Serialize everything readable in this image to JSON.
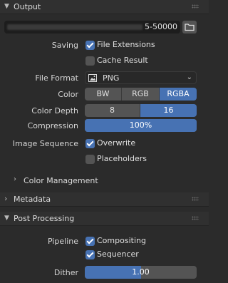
{
  "output": {
    "header": "Output",
    "path_value": "5-50000",
    "saving_label": "Saving",
    "file_extensions_label": "File Extensions",
    "file_extensions_checked": true,
    "cache_result_label": "Cache Result",
    "cache_result_checked": false,
    "file_format_label": "File Format",
    "file_format_value": "PNG",
    "color_label": "Color",
    "color_options": [
      "BW",
      "RGB",
      "RGBA"
    ],
    "color_selected": "RGBA",
    "color_depth_label": "Color Depth",
    "color_depth_options": [
      "8",
      "16"
    ],
    "color_depth_selected": "16",
    "compression_label": "Compression",
    "compression_value": "100%",
    "compression_fraction": 1.0,
    "image_sequence_label": "Image Sequence",
    "overwrite_label": "Overwrite",
    "overwrite_checked": true,
    "placeholders_label": "Placeholders",
    "placeholders_checked": false,
    "color_management_label": "Color Management"
  },
  "metadata": {
    "header": "Metadata"
  },
  "post_processing": {
    "header": "Post Processing",
    "pipeline_label": "Pipeline",
    "compositing_label": "Compositing",
    "compositing_checked": true,
    "sequencer_label": "Sequencer",
    "sequencer_checked": true,
    "dither_label": "Dither",
    "dither_value": "1.00",
    "dither_fraction": 0.5
  },
  "colors": {
    "accent": "#4772b3",
    "field": "#545454",
    "background": "#2b2b2b"
  }
}
